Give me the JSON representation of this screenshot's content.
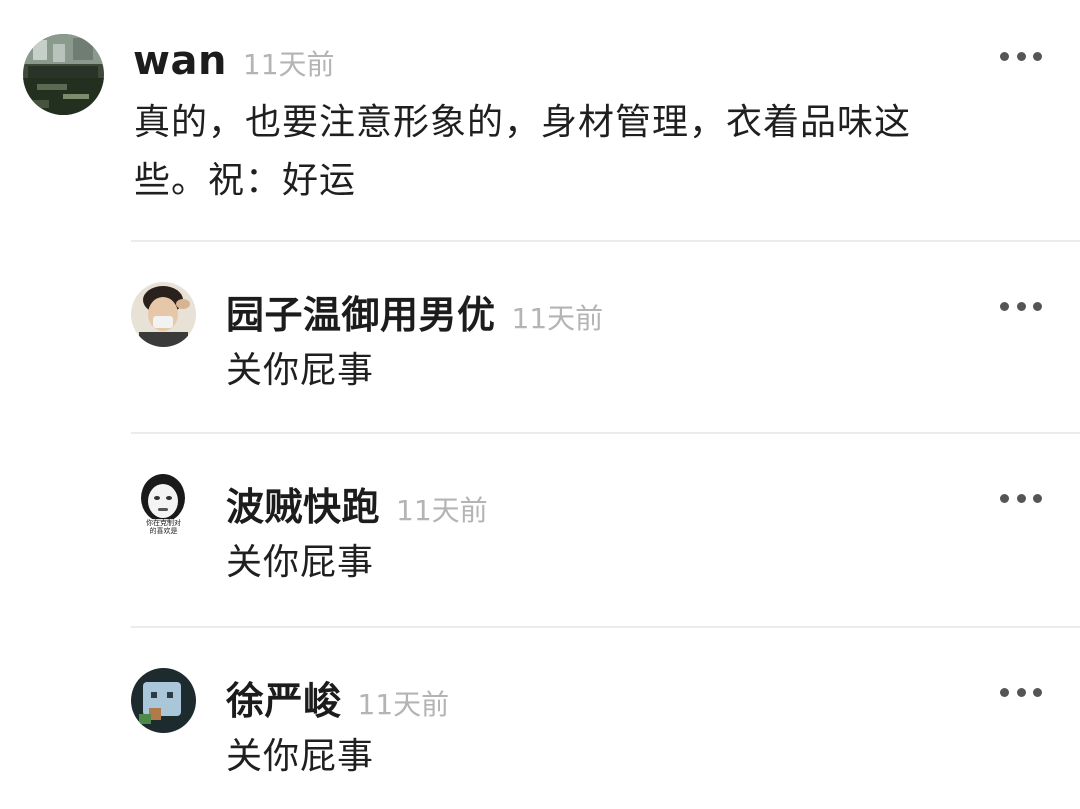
{
  "comments": [
    {
      "username": "wan",
      "time": "11天前",
      "text": "真的，也要注意形象的，身材管理，衣着品味这些。祝：好运",
      "text_line1": "真的，也要注意形象的，身材管理，衣着品味这",
      "text_line2": "些。祝：好运"
    },
    {
      "username": "园子温御用男优",
      "time": "11天前",
      "text": "关你屁事"
    },
    {
      "username": "波贼快跑",
      "time": "11天前",
      "text": "关你屁事",
      "avatar_caption_line1": "你在克制对",
      "avatar_caption_line2": "的喜欢是"
    },
    {
      "username": "徐严峻",
      "time": "11天前",
      "text": "关你屁事"
    }
  ],
  "icons": {
    "more": "more-dots-icon"
  },
  "colors": {
    "username": "#1c1c1c",
    "time": "#b4b4b4",
    "text": "#1f1f1f",
    "divider": "#ececec",
    "more_dots": "#555555"
  }
}
